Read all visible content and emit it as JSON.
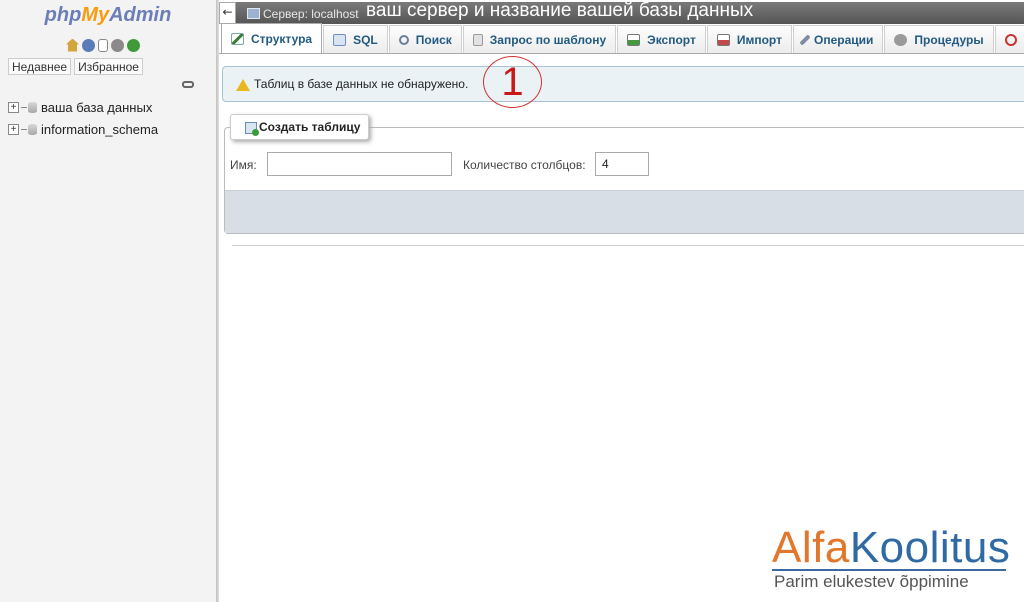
{
  "nav": {
    "logo": {
      "php": "php",
      "my": "My",
      "admin": "Admin"
    },
    "tabs": [
      "Недавнее",
      "Избранное"
    ],
    "databases": [
      {
        "name": "ваша база данных"
      },
      {
        "name": "information_schema"
      }
    ]
  },
  "topbar": {
    "server_label": "Сервер: localhost",
    "annotation": "ваш сервер и название вашей базы данных"
  },
  "tabs": [
    {
      "label": "Структура",
      "icon": "structure-icon",
      "active": true
    },
    {
      "label": "SQL",
      "icon": "sql-icon"
    },
    {
      "label": "Поиск",
      "icon": "search-icon"
    },
    {
      "label": "Запрос по шаблону",
      "icon": "query-icon"
    },
    {
      "label": "Экспорт",
      "icon": "export-icon"
    },
    {
      "label": "Импорт",
      "icon": "import-icon"
    },
    {
      "label": "Операции",
      "icon": "operations-icon"
    },
    {
      "label": "Процедуры",
      "icon": "routines-icon"
    }
  ],
  "notice": {
    "text": "Таблиц в базе данных не обнаружено."
  },
  "annotation_number": "1",
  "create_table": {
    "legend": "Создать таблицу",
    "name_label": "Имя:",
    "name_value": "",
    "columns_label": "Количество столбцов:",
    "columns_value": "4"
  },
  "brand": {
    "part1": "Alfa",
    "part2": "Koolitus",
    "tagline": "Parim elukestev õppimine",
    "colors": {
      "orange": "#e2762b",
      "blue": "#2f6aa5"
    }
  }
}
